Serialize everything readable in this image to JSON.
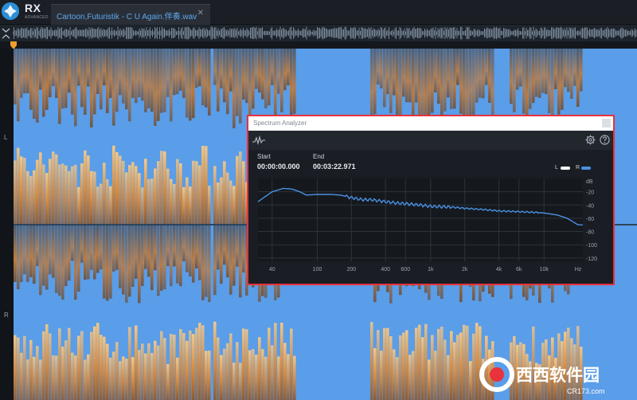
{
  "app": {
    "logo_text": "RX",
    "logo_sub": "ADVANCED"
  },
  "tab": {
    "title": "Cartoon,Futuristik - C U Again.伴奏.wav",
    "close": "✕"
  },
  "channels": {
    "left": "L",
    "right": "R"
  },
  "spectrum_analyzer": {
    "title": "Spectrum Analyzer",
    "start_label": "Start",
    "start_value": "00:00:00.000",
    "end_label": "End",
    "end_value": "00:03:22.971",
    "legend": [
      {
        "label": "L",
        "color": "#ffffff"
      },
      {
        "label": "R",
        "color": "#4a90e2"
      }
    ],
    "chart_data": {
      "type": "line",
      "x_scale": "log",
      "xlim": [
        30,
        22000
      ],
      "ylim": [
        -125,
        0
      ],
      "x_tick_labels": [
        "40",
        "100",
        "200",
        "400",
        "600",
        "1k",
        "2k",
        "4k",
        "6k",
        "10k",
        "Hz"
      ],
      "x_ticks_hz": [
        40,
        100,
        200,
        400,
        600,
        1000,
        2000,
        4000,
        6000,
        10000
      ],
      "y_tick_labels": [
        "dB",
        "-20",
        "-40",
        "-60",
        "-80",
        "-100",
        "-120"
      ],
      "y_ticks_db": [
        -20,
        -40,
        -60,
        -80,
        -100,
        -120
      ],
      "series": [
        {
          "color": "#4a90e2",
          "x": [
            30,
            40,
            50,
            60,
            70,
            80,
            100,
            130,
            160,
            200,
            250,
            300,
            400,
            500,
            600,
            800,
            1000,
            1500,
            2000,
            3000,
            4000,
            6000,
            8000,
            10000,
            13000,
            16000,
            20000
          ],
          "y": [
            -35,
            -20,
            -15,
            -16,
            -20,
            -25,
            -24,
            -24,
            -25,
            -29,
            -32,
            -32,
            -35,
            -37,
            -38,
            -40,
            -42,
            -43,
            -45,
            -47,
            -49,
            -50,
            -51,
            -52,
            -55,
            -60,
            -70
          ]
        }
      ]
    }
  },
  "watermark": {
    "text": "西西软件园",
    "sub": "CR173.com"
  }
}
